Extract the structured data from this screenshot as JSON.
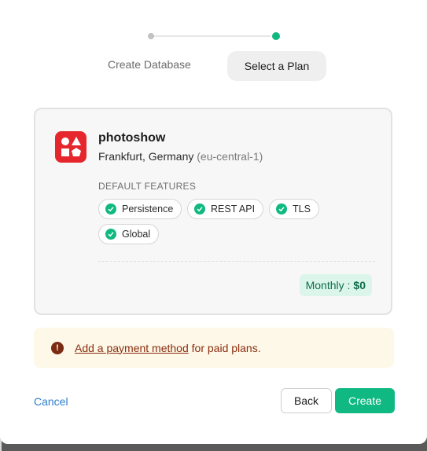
{
  "stepper": {
    "steps": [
      {
        "label": "Create Database",
        "state": "completed"
      },
      {
        "label": "Select a Plan",
        "state": "active"
      }
    ]
  },
  "database": {
    "name": "photoshow",
    "region": "Frankfurt, Germany",
    "region_code": "(eu-central-1)",
    "features_label": "DEFAULT FEATURES",
    "features": [
      "Persistence",
      "REST API",
      "TLS",
      "Global"
    ],
    "price_label": "Monthly :",
    "price_value": "$0"
  },
  "alert": {
    "link_text": "Add a payment method",
    "suffix": "for paid plans.",
    "icon": "exclamation-circle-icon"
  },
  "actions": {
    "cancel_label": "Cancel",
    "back_label": "Back",
    "create_label": "Create"
  },
  "colors": {
    "accent": "#10b981",
    "logo": "#e5272d",
    "alert_text": "#8a2d0e",
    "link_blue": "#2f7dd1"
  }
}
